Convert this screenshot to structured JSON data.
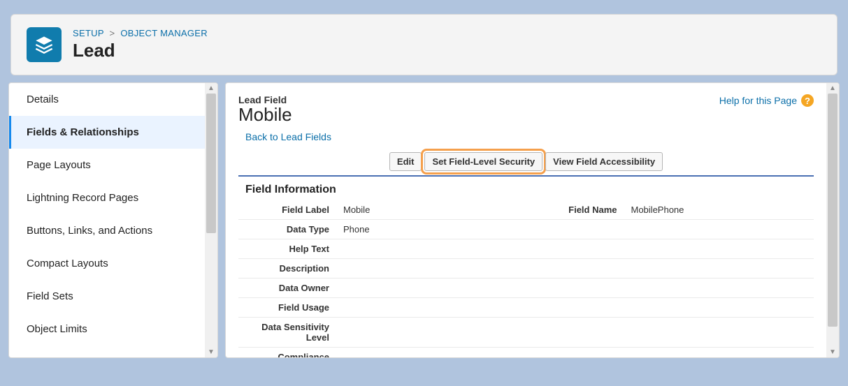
{
  "breadcrumb": {
    "root": "SETUP",
    "section": "OBJECT MANAGER"
  },
  "page_title": "Lead",
  "sidebar": {
    "items": [
      {
        "label": "Details",
        "active": false
      },
      {
        "label": "Fields & Relationships",
        "active": true
      },
      {
        "label": "Page Layouts",
        "active": false
      },
      {
        "label": "Lightning Record Pages",
        "active": false
      },
      {
        "label": "Buttons, Links, and Actions",
        "active": false
      },
      {
        "label": "Compact Layouts",
        "active": false
      },
      {
        "label": "Field Sets",
        "active": false
      },
      {
        "label": "Object Limits",
        "active": false
      }
    ]
  },
  "main": {
    "eyebrow": "Lead Field",
    "field_title": "Mobile",
    "back_link": "Back to Lead Fields",
    "help_link": "Help for this Page",
    "buttons": {
      "edit": "Edit",
      "set_fls": "Set Field-Level Security",
      "view_accessibility": "View Field Accessibility"
    },
    "section_heading": "Field Information",
    "rows": {
      "field_label_lbl": "Field Label",
      "field_label_val": "Mobile",
      "field_name_lbl": "Field Name",
      "field_name_val": "MobilePhone",
      "data_type_lbl": "Data Type",
      "data_type_val": "Phone",
      "help_text_lbl": "Help Text",
      "help_text_val": "",
      "description_lbl": "Description",
      "description_val": "",
      "data_owner_lbl": "Data Owner",
      "data_owner_val": "",
      "field_usage_lbl": "Field Usage",
      "field_usage_val": "",
      "sensitivity_lbl": "Data Sensitivity Level",
      "sensitivity_val": "",
      "compliance_lbl": "Compliance Categorization",
      "compliance_val": ""
    }
  }
}
